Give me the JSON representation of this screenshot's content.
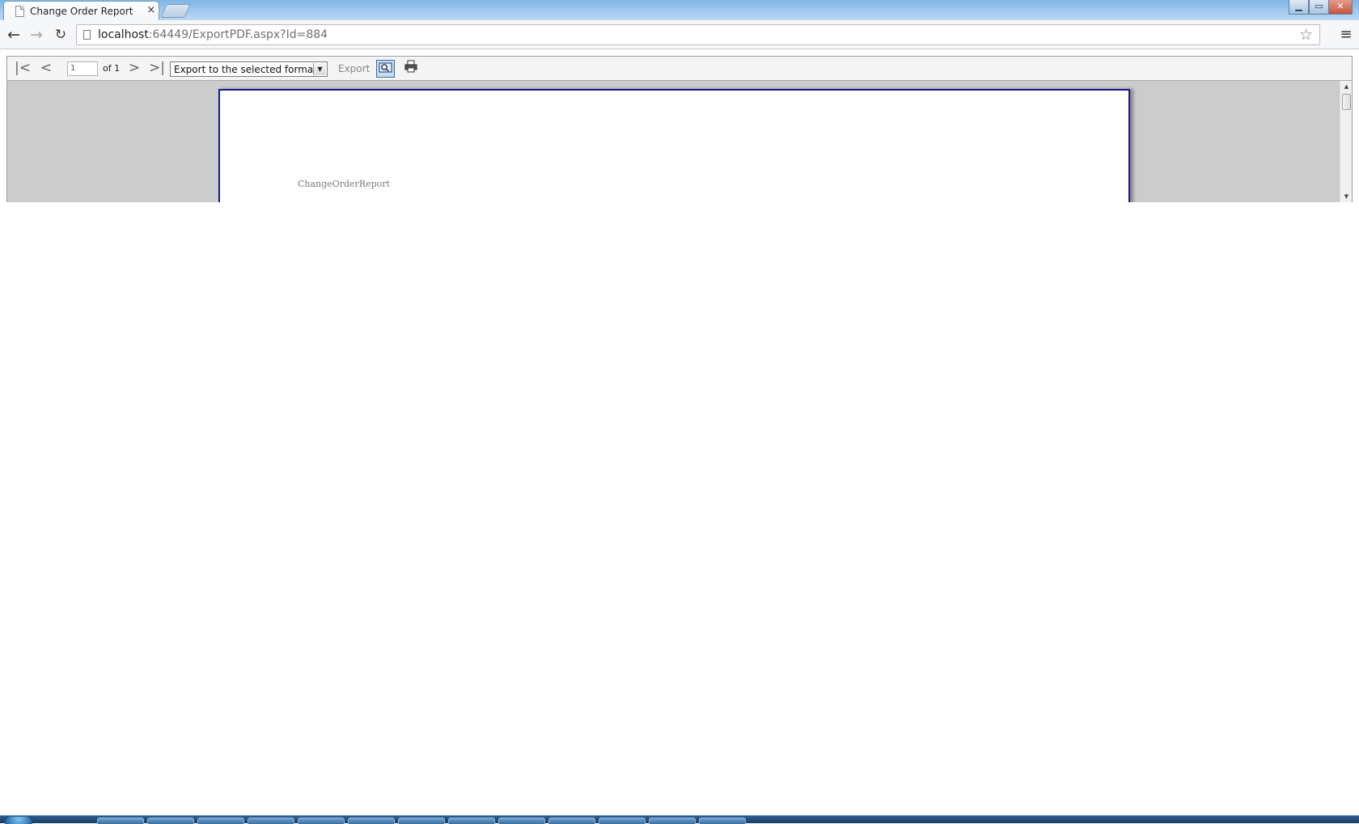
{
  "browser": {
    "tab": {
      "title": "Change Order Report",
      "close_glyph": "×",
      "icon": "page-icon"
    },
    "window_controls": {
      "minimize": "▁",
      "maximize": "▭",
      "close": "✕"
    },
    "nav": {
      "back": "←",
      "forward": "→",
      "reload": "↻"
    },
    "address": {
      "host": "localhost",
      "path": ":64449/ExportPDF.aspx?Id=884"
    },
    "bookmark_star": "☆",
    "menu": "≡"
  },
  "report_viewer": {
    "toolbar": {
      "first_page": "|<",
      "previous_page": "<",
      "current_page": "1",
      "page_of": "of 1",
      "next_page": ">",
      "last_page": ">|",
      "export_format": "Export to the selected format",
      "dropdown_arrow": "▼",
      "export_label": "Export",
      "find_icon": "search-icon",
      "print_icon": "print-icon"
    },
    "page": {
      "report_title": "ChangeOrderReport"
    },
    "scrollbar": {
      "up": "▲",
      "down": "▼"
    }
  },
  "colors": {
    "page_border": "#1a1a8a",
    "viewer_background": "#cccccc",
    "toolbar_background": "#f4f4f4",
    "taskbar": "#183d63"
  }
}
